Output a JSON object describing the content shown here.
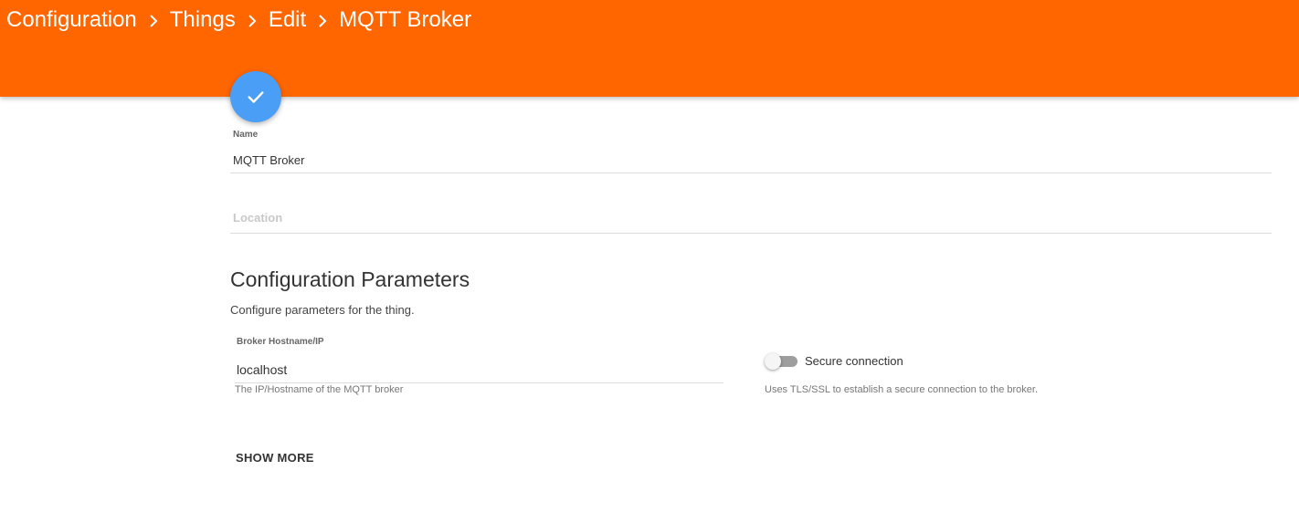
{
  "breadcrumb": {
    "items": [
      "Configuration",
      "Things",
      "Edit",
      "MQTT Broker"
    ]
  },
  "colors": {
    "header": "#ff6600",
    "fab": "#4a9ef5"
  },
  "form": {
    "name_label": "Name",
    "name_value": "MQTT Broker",
    "location_placeholder": "Location"
  },
  "config": {
    "title": "Configuration Parameters",
    "description": "Configure parameters for the thing.",
    "broker_label": "Broker Hostname/IP",
    "broker_value": "localhost",
    "broker_hint": "The IP/Hostname of the MQTT broker",
    "secure_label": "Secure connection",
    "secure_hint": "Uses TLS/SSL to establish a secure connection to the broker.",
    "secure_enabled": false
  },
  "actions": {
    "save_icon": "check-icon",
    "show_more_label": "SHOW MORE"
  }
}
